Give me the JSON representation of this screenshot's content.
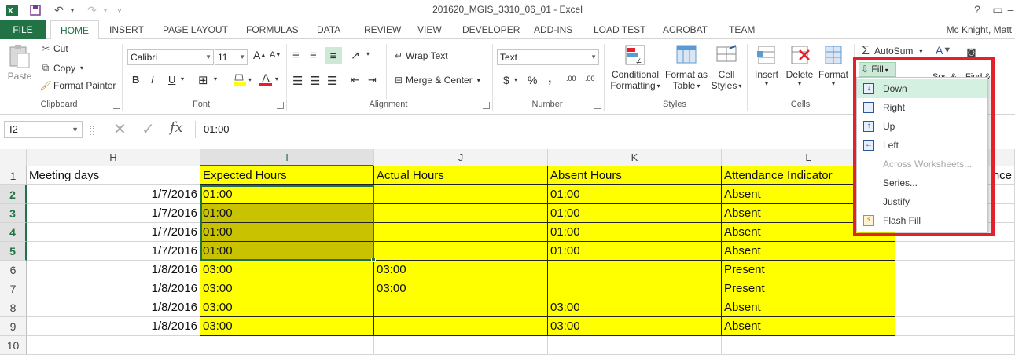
{
  "window": {
    "title": "201620_MGIS_3310_06_01 - Excel",
    "app_icon": "excel-icon",
    "controls": [
      "?",
      "minimize",
      "restore",
      "close"
    ]
  },
  "ribbon_tabs": [
    "FILE",
    "HOME",
    "INSERT",
    "PAGE LAYOUT",
    "FORMULAS",
    "DATA",
    "REVIEW",
    "VIEW",
    "DEVELOPER",
    "ADD-INS",
    "LOAD TEST",
    "ACROBAT",
    "TEAM"
  ],
  "user": "Mc Knight, Matt",
  "clipboard": {
    "paste": "Paste",
    "cut": "Cut",
    "copy": "Copy",
    "format_painter": "Format Painter",
    "label": "Clipboard"
  },
  "font": {
    "name": "Calibri",
    "size": "11",
    "bold": "B",
    "italic": "I",
    "underline": "U",
    "label": "Font",
    "grow": "A",
    "shrink": "A",
    "font_color_glyph": "A"
  },
  "alignment": {
    "wrap_text": "Wrap Text",
    "merge_center": "Merge & Center",
    "label": "Alignment"
  },
  "number": {
    "format": "Text",
    "currency": "$",
    "percent": "%",
    "comma": ",",
    "inc_decimal": ".00",
    "dec_decimal": ".00",
    "label": "Number"
  },
  "styles": {
    "conditional_1": "Conditional",
    "conditional_2": "Formatting",
    "format_table_1": "Format as",
    "format_table_2": "Table",
    "cell_styles_1": "Cell",
    "cell_styles_2": "Styles",
    "label": "Styles"
  },
  "cells": {
    "insert": "Insert",
    "delete": "Delete",
    "format": "Format",
    "label": "Cells"
  },
  "editing": {
    "autosum": "AutoSum",
    "fill": "Fill",
    "sort_partial": "Sort &",
    "find_partial": "Find &"
  },
  "fill_menu": [
    {
      "label": "Down",
      "icon": "fill-down-icon",
      "state": "highlighted"
    },
    {
      "label": "Right",
      "icon": "fill-right-icon",
      "state": "normal"
    },
    {
      "label": "Up",
      "icon": "fill-up-icon",
      "state": "normal"
    },
    {
      "label": "Left",
      "icon": "fill-left-icon",
      "state": "normal"
    },
    {
      "label": "Across Worksheets...",
      "icon": "",
      "state": "disabled"
    },
    {
      "label": "Series...",
      "icon": "",
      "state": "normal"
    },
    {
      "label": "Justify",
      "icon": "",
      "state": "normal"
    },
    {
      "label": "Flash Fill",
      "icon": "flash-fill-icon",
      "state": "normal"
    }
  ],
  "formula_bar": {
    "name_box": "I2",
    "formula": "01:00",
    "fx": "fx"
  },
  "sheet": {
    "columns": [
      "H",
      "I",
      "J",
      "K",
      "L"
    ],
    "selected_column": "I",
    "rows": [
      {
        "n": "1",
        "H": "Meeting days",
        "I": "Expected Hours",
        "J": "Actual Hours",
        "K": "Absent Hours",
        "L": "Attendance Indicator",
        "M_partial": "nce"
      },
      {
        "n": "2",
        "H": "1/7/2016",
        "I": "01:00",
        "J": "",
        "K": "01:00",
        "L": "Absent"
      },
      {
        "n": "3",
        "H": "1/7/2016",
        "I": "01:00",
        "J": "",
        "K": "01:00",
        "L": "Absent"
      },
      {
        "n": "4",
        "H": "1/7/2016",
        "I": "01:00",
        "J": "",
        "K": "01:00",
        "L": "Absent"
      },
      {
        "n": "5",
        "H": "1/7/2016",
        "I": "01:00",
        "J": "",
        "K": "01:00",
        "L": "Absent"
      },
      {
        "n": "6",
        "H": "1/8/2016",
        "I": "03:00",
        "J": "03:00",
        "K": "",
        "L": "Present"
      },
      {
        "n": "7",
        "H": "1/8/2016",
        "I": "03:00",
        "J": "03:00",
        "K": "",
        "L": "Present"
      },
      {
        "n": "8",
        "H": "1/8/2016",
        "I": "03:00",
        "J": "",
        "K": "03:00",
        "L": "Absent"
      },
      {
        "n": "9",
        "H": "1/8/2016",
        "I": "03:00",
        "J": "",
        "K": "03:00",
        "L": "Absent"
      },
      {
        "n": "10",
        "H": "",
        "I": "",
        "J": "",
        "K": "",
        "L": ""
      }
    ],
    "selected_rows": [
      "2",
      "3",
      "4",
      "5"
    ]
  },
  "colors": {
    "excel_green": "#217346",
    "highlight_yellow": "#ffff00",
    "selection_yellow": "#c8c200",
    "annotation_red": "#e3202b"
  }
}
